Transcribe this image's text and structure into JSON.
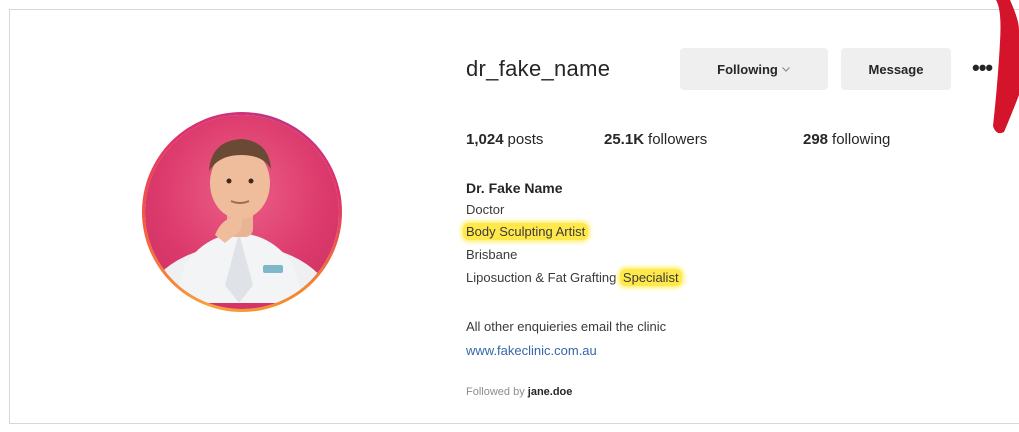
{
  "profile": {
    "username": "dr_fake_name",
    "following_label": "Following",
    "message_label": "Message",
    "more_label": "•••"
  },
  "stats": {
    "posts_count": "1,024",
    "posts_label": "posts",
    "followers_count": "25.1K",
    "followers_label": "followers",
    "following_count": "298",
    "following_label": "following"
  },
  "bio": {
    "name": "Dr. Fake Name",
    "line1": "Doctor",
    "line2": "Body Sculpting Artist",
    "line3": "Brisbane",
    "line4_prefix": "Liposuction & Fat Grafting ",
    "line4_highlight": "Specialist",
    "line5": "All other enquieries email the clinic",
    "website": "www.fakeclinic.com.au",
    "followed_by_prefix": "Followed by",
    "followed_by_user": "jane.doe"
  },
  "colors": {
    "highlight": "#ffe84a",
    "annotation_arrow": "#d4142a",
    "link": "#3567a8"
  },
  "icons": {
    "chevron": "chevron-down-icon",
    "more": "more-options-icon"
  }
}
